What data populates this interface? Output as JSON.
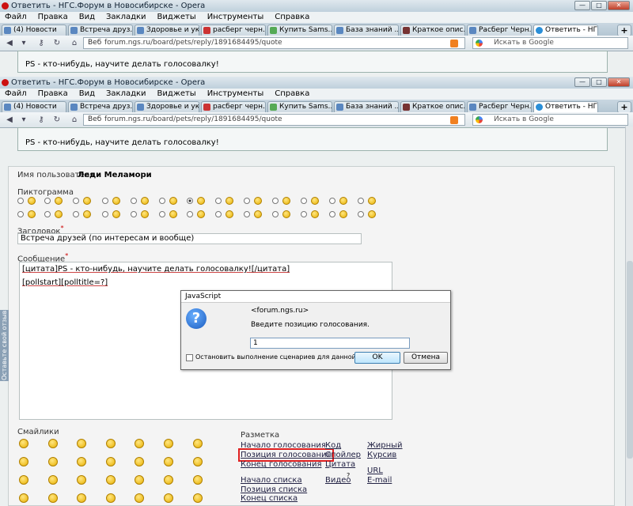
{
  "window": {
    "title": "Ответить - НГС.Форум в Новосибирске - Opera",
    "min": "—",
    "max": "□",
    "close": "✕"
  },
  "menu": [
    "Файл",
    "Правка",
    "Вид",
    "Закладки",
    "Виджеты",
    "Инструменты",
    "Справка"
  ],
  "tabs_top": [
    {
      "label": "(4) Новости",
      "active": false
    },
    {
      "label": "Встреча друз...",
      "active": false
    },
    {
      "label": "Здоровье и ук...",
      "active": false
    },
    {
      "label": "расберг черн...",
      "active": false
    },
    {
      "label": "Купить Sams...",
      "active": false
    },
    {
      "label": "База знаний ...",
      "active": false
    },
    {
      "label": "Краткое опис...",
      "active": false
    },
    {
      "label": "Расберг Черн...",
      "active": false
    },
    {
      "label": "Ответить - НГ...",
      "active": true
    }
  ],
  "tabs_bottom": [
    {
      "label": "(4) Новости",
      "active": false
    },
    {
      "label": "Встреча друз...",
      "active": false
    },
    {
      "label": "Здоровье и ук...",
      "active": false
    },
    {
      "label": "расберг черн...",
      "active": false
    },
    {
      "label": "Купить Sams...",
      "active": false
    },
    {
      "label": "База знаний ...",
      "active": false
    },
    {
      "label": "Краткое опис...",
      "active": false
    },
    {
      "label": "Расберг Черн...",
      "active": false
    },
    {
      "label": "Ответить - НГ...",
      "active": true
    }
  ],
  "tab_plus": "+",
  "address": {
    "web_label": "Веб",
    "url": "forum.ngs.ru/board/pets/reply/1891684495/quote",
    "search_placeholder": "Искать в Google"
  },
  "nav_icons": [
    "back-icon",
    "forward-icon",
    "key-icon",
    "reload-icon",
    "home-icon"
  ],
  "quote_text": "PS - кто-нибудь, научите делать голосовалку!",
  "form": {
    "username_label": "Имя пользователя",
    "username": "Леди Меламори",
    "pictogram_label": "Пиктограмма",
    "title_label": "Заголовок",
    "title_value": "Встреча друзей (по интересам и вообще)",
    "message_label": "Сообщение",
    "req": "*",
    "message_line1": "[цитата]PS - кто-нибудь, научите делать голосовалку![/цитата]",
    "message_line2": "[pollstart][polltitle=?]",
    "smileys_label": "Смайлики",
    "markup_label": "Разметка",
    "markup_col1": [
      "Начало голосования",
      "Позиция голосования",
      "Конец голосования",
      "",
      "Начало списка",
      "Позиция списка",
      "Конец списка"
    ],
    "markup_col2": [
      "Код",
      "Спойлер",
      "Цитата",
      "",
      "Видео"
    ],
    "video_sup": "?",
    "markup_col3": [
      "Жирный",
      "Курсив",
      "",
      "URL",
      "E-mail"
    ]
  },
  "side_tab": "Оставьте свой отзыв",
  "dialog": {
    "title": "JavaScript",
    "host": "<forum.ngs.ru>",
    "prompt": "Введите позицию голосования.",
    "value": "1",
    "checkbox": "Остановить выполнение сценариев для данной страницы",
    "ok": "OK",
    "cancel": "Отмена"
  },
  "colors": {
    "highlight": "#e02020",
    "link": "#224"
  }
}
